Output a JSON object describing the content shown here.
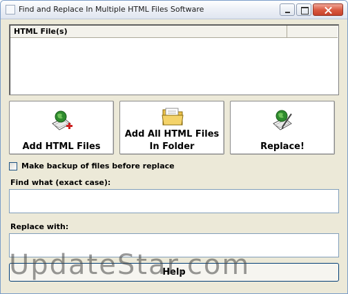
{
  "window": {
    "title": "Find and Replace In Multiple HTML Files Software"
  },
  "file_list": {
    "columns": [
      "HTML File(s)",
      ""
    ]
  },
  "buttons": {
    "add_files": "Add HTML Files",
    "add_folder_line1": "Add All HTML Files",
    "add_folder_line2": "In Folder",
    "replace": "Replace!",
    "help": "Help"
  },
  "options": {
    "backup_label": "Make backup of files before replace",
    "backup_checked": false
  },
  "fields": {
    "find_label": "Find what (exact case):",
    "find_value": "",
    "replace_label": "Replace with:",
    "replace_value": ""
  },
  "watermark": "UpdateStar.com",
  "icons": {
    "add_files": "globe-page-plus-icon",
    "add_folder": "folder-icon",
    "replace": "globe-pen-icon"
  },
  "colors": {
    "window_bg": "#ece9d8",
    "close_button": "#d8583f",
    "globe_green": "#2e8b2e",
    "folder_yellow": "#e9c04a"
  }
}
